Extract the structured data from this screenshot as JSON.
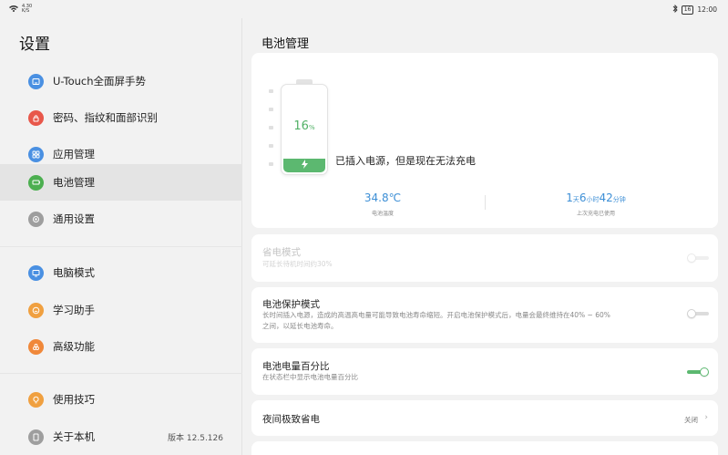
{
  "status_bar": {
    "network_top": "4.30",
    "network_bottom": "K/S",
    "battery": "16",
    "time": "12:00"
  },
  "sidebar": {
    "title": "设置",
    "items": [
      {
        "label": "U-Touch全面屏手势",
        "icon": "gesture-icon",
        "color": "#4a90e2"
      },
      {
        "label": "密码、指纹和面部识别",
        "icon": "lock-icon",
        "color": "#e8574a"
      },
      {
        "label": "应用管理",
        "icon": "apps-icon",
        "color": "#4a90e2"
      },
      {
        "label": "电池管理",
        "icon": "battery-icon",
        "color": "#4caf50"
      },
      {
        "label": "通用设置",
        "icon": "gear-icon",
        "color": "#9e9e9e"
      },
      {
        "label": "电脑模式",
        "icon": "monitor-icon",
        "color": "#4a90e2"
      },
      {
        "label": "学习助手",
        "icon": "smile-icon",
        "color": "#f0a040"
      },
      {
        "label": "高级功能",
        "icon": "advanced-icon",
        "color": "#f0883a"
      },
      {
        "label": "使用技巧",
        "icon": "tips-icon",
        "color": "#f0a040"
      },
      {
        "label": "关于本机",
        "icon": "info-icon",
        "color": "#9e9e9e",
        "extra": "版本 12.5.126"
      }
    ]
  },
  "main": {
    "title": "电池管理",
    "battery": {
      "percent": "16",
      "percent_unit": "%",
      "level_fraction": 0.16,
      "status_message": "已插入电源，但是现在无法充电",
      "temperature": "34.8℃",
      "temperature_label": "电池温度",
      "usage_days": "1",
      "usage_days_unit": "天",
      "usage_hours": "6",
      "usage_hours_unit": "小时",
      "usage_minutes": "42",
      "usage_minutes_unit": "分钟",
      "usage_label": "上次充电已使用"
    },
    "power_saving": {
      "title": "省电模式",
      "subtitle": "可延长待机时间约30%",
      "enabled": false
    },
    "battery_protection": {
      "title": "电池保护模式",
      "subtitle_line1": "长时间插入电源，造成的高温高电量可能导致电池寿命缩短。开启电池保护模式后，电量会最终维持在40% ~ 60%",
      "subtitle_line2": "之间，以延长电池寿命。",
      "enabled": false
    },
    "battery_percentage": {
      "title": "电池电量百分比",
      "subtitle": "在状态栏中显示电池电量百分比",
      "enabled": true
    },
    "night_saving": {
      "title": "夜间极致省电",
      "value": "关闭"
    }
  },
  "colors": {
    "accent_green": "#5cb870",
    "stat_blue": "#3d8fd6"
  }
}
